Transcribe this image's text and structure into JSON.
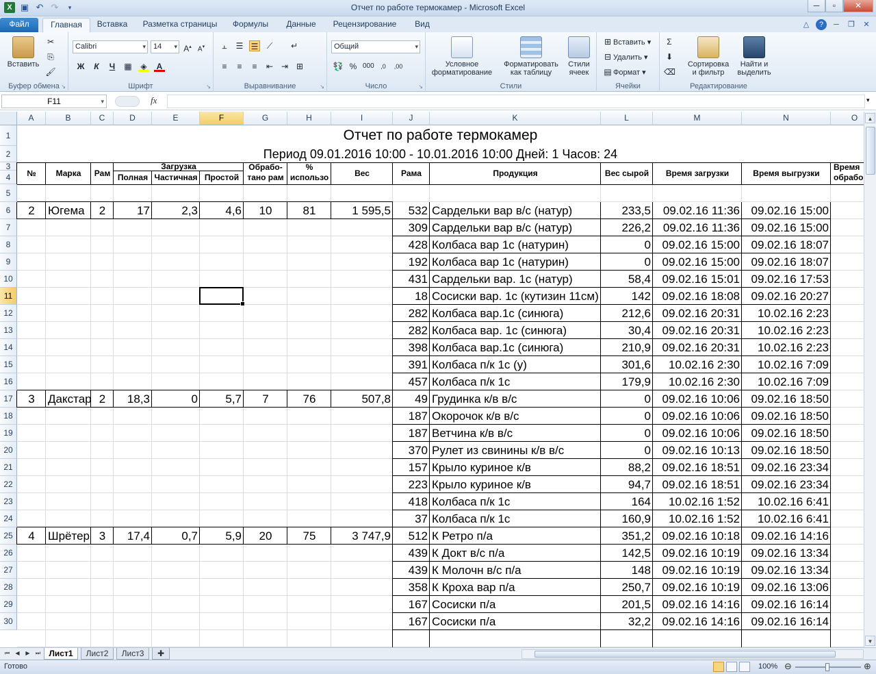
{
  "window": {
    "title": "Отчет по работе термокамер  -  Microsoft Excel",
    "min_icon": "minimize-icon",
    "max_icon": "maximize-icon",
    "close_icon": "close-icon"
  },
  "ribbon_tabs": [
    "Файл",
    "Главная",
    "Вставка",
    "Разметка страницы",
    "Формулы",
    "Данные",
    "Рецензирование",
    "Вид"
  ],
  "active_tab": "Главная",
  "ribbon": {
    "clipboard": {
      "label": "Буфер обмена",
      "paste": "Вставить"
    },
    "font": {
      "label": "Шрифт",
      "name": "Calibri",
      "size": "14",
      "bold": "Ж",
      "italic": "К",
      "underline": "Ч"
    },
    "alignment": {
      "label": "Выравнивание"
    },
    "number": {
      "label": "Число",
      "format": "Общий"
    },
    "styles": {
      "label": "Стили",
      "conditional": "Условное форматирование",
      "as_table": "Форматировать как таблицу",
      "cell_styles": "Стили ячеек"
    },
    "cells": {
      "label": "Ячейки",
      "insert": "Вставить",
      "delete": "Удалить",
      "format": "Формат"
    },
    "editing": {
      "label": "Редактирование",
      "sort": "Сортировка и фильтр",
      "find": "Найти и выделить"
    }
  },
  "formula_bar": {
    "name_box": "F11",
    "fx": "fx",
    "content": ""
  },
  "columns": [
    "A",
    "B",
    "C",
    "D",
    "E",
    "F",
    "G",
    "H",
    "I",
    "J",
    "K",
    "L",
    "M",
    "N",
    "O"
  ],
  "selected_column": "F",
  "rows": [
    "1",
    "2",
    "3",
    "4",
    "5",
    "6",
    "7",
    "8",
    "9",
    "10",
    "11",
    "12",
    "13",
    "14",
    "15",
    "16",
    "17",
    "18",
    "19",
    "20",
    "21",
    "22",
    "23",
    "24",
    "25",
    "26",
    "27",
    "28",
    "29",
    "30"
  ],
  "selected_row": "11",
  "sheet": {
    "title": "Отчет по работе термокамер",
    "period": "Период 09.01.2016 10:00 - 10.01.2016 10:00  Дней: 1  Часов: 24",
    "headers": {
      "num": "№",
      "brand": "Марка",
      "frames": "Рам",
      "load": "Загрузка",
      "full": "Полная",
      "partial": "Частичная",
      "idle": "Простой",
      "processed_1": "Обрабо-",
      "processed_2": "тано рам",
      "percent_1": "%",
      "percent_2": "использо",
      "weight": "Вес",
      "frame": "Рама",
      "product": "Продукция",
      "raw_weight": "Вес сырой",
      "load_time": "Время загрузки",
      "unload_time": "Время выгрузки",
      "proc_time_1": "Время",
      "proc_time_2": "обрабо"
    },
    "chambers": [
      {
        "num": "2",
        "brand": "Югема",
        "frames": "2",
        "full": "17",
        "partial": "2,3",
        "idle": "4,6",
        "processed": "10",
        "percent": "81",
        "weight": "1 595,5"
      },
      {
        "num": "3",
        "brand": "Дакстар",
        "frames": "2",
        "full": "18,3",
        "partial": "0",
        "idle": "5,7",
        "processed": "7",
        "percent": "76",
        "weight": "507,8"
      },
      {
        "num": "4",
        "brand": "Шрётер",
        "frames": "3",
        "full": "17,4",
        "partial": "0,7",
        "idle": "5,9",
        "processed": "20",
        "percent": "75",
        "weight": "3 747,9"
      }
    ],
    "items": [
      {
        "frame": "532",
        "product": "Сардельки  вар в/с (натур)",
        "raw": "233,5",
        "load": "09.02.16 11:36",
        "unload": "09.02.16 15:00"
      },
      {
        "frame": "309",
        "product": "Сардельки вар в/с (натур)",
        "raw": "226,2",
        "load": "09.02.16 11:36",
        "unload": "09.02.16 15:00"
      },
      {
        "frame": "428",
        "product": "Колбаса  вар 1с (натурин)",
        "raw": "0",
        "load": "09.02.16 15:00",
        "unload": "09.02.16 18:07"
      },
      {
        "frame": "192",
        "product": "Колбаса вар 1с (натурин)",
        "raw": "0",
        "load": "09.02.16 15:00",
        "unload": "09.02.16 18:07"
      },
      {
        "frame": "431",
        "product": "Сардельки вар. 1с (натур)",
        "raw": "58,4",
        "load": "09.02.16 15:01",
        "unload": "09.02.16 17:53"
      },
      {
        "frame": "18",
        "product": "Сосиски вар. 1с (кутизин 11см)",
        "raw": "142",
        "load": "09.02.16 18:08",
        "unload": "09.02.16 20:27"
      },
      {
        "frame": "282",
        "product": "Колбаса  вар.1с (синюга)",
        "raw": "212,6",
        "load": "09.02.16 20:31",
        "unload": "10.02.16 2:23"
      },
      {
        "frame": "282",
        "product": "Колбаса вар. 1с (синюга)",
        "raw": "30,4",
        "load": "09.02.16 20:31",
        "unload": "10.02.16 2:23"
      },
      {
        "frame": "398",
        "product": "Колбаса вар.1с (синюга)",
        "raw": "210,9",
        "load": "09.02.16 20:31",
        "unload": "10.02.16 2:23"
      },
      {
        "frame": "391",
        "product": "Колбаса п/к 1с (у)",
        "raw": "301,6",
        "load": "10.02.16 2:30",
        "unload": "10.02.16 7:09"
      },
      {
        "frame": "457",
        "product": "Колбаса  п/к 1с",
        "raw": "179,9",
        "load": "10.02.16 2:30",
        "unload": "10.02.16 7:09"
      },
      {
        "frame": "49",
        "product": "Грудинка  к/в в/с",
        "raw": "0",
        "load": "09.02.16 10:06",
        "unload": "09.02.16 18:50"
      },
      {
        "frame": "187",
        "product": "Окорочок к/в в/с",
        "raw": "0",
        "load": "09.02.16 10:06",
        "unload": "09.02.16 18:50"
      },
      {
        "frame": "187",
        "product": "Ветчина  к/в в/с",
        "raw": "0",
        "load": "09.02.16 10:06",
        "unload": "09.02.16 18:50"
      },
      {
        "frame": "370",
        "product": "Рулет  из свинины к/в в/с",
        "raw": "0",
        "load": "09.02.16 10:13",
        "unload": "09.02.16 18:50"
      },
      {
        "frame": "157",
        "product": "Крыло куриное к/в",
        "raw": "88,2",
        "load": "09.02.16 18:51",
        "unload": "09.02.16 23:34"
      },
      {
        "frame": "223",
        "product": "Крыло куриное к/в",
        "raw": "94,7",
        "load": "09.02.16 18:51",
        "unload": "09.02.16 23:34"
      },
      {
        "frame": "418",
        "product": "Колбаса  п/к 1с",
        "raw": "164",
        "load": "10.02.16 1:52",
        "unload": "10.02.16 6:41"
      },
      {
        "frame": "37",
        "product": "Колбаса  п/к 1с",
        "raw": "160,9",
        "load": "10.02.16 1:52",
        "unload": "10.02.16 6:41"
      },
      {
        "frame": "512",
        "product": "К Ретро  п/а",
        "raw": "351,2",
        "load": "09.02.16 10:18",
        "unload": "09.02.16 14:16"
      },
      {
        "frame": "439",
        "product": "К Докт в/с п/а",
        "raw": "142,5",
        "load": "09.02.16 10:19",
        "unload": "09.02.16 13:34"
      },
      {
        "frame": "439",
        "product": "К Молочн в/с п/а",
        "raw": "148",
        "load": "09.02.16 10:19",
        "unload": "09.02.16 13:34"
      },
      {
        "frame": "358",
        "product": "К Кроха вар п/а",
        "raw": "250,7",
        "load": "09.02.16 10:19",
        "unload": "09.02.16 13:06"
      },
      {
        "frame": "167",
        "product": "Сосиски п/а",
        "raw": "201,5",
        "load": "09.02.16 14:16",
        "unload": "09.02.16 16:14"
      },
      {
        "frame": "167",
        "product": "Сосиски п/а",
        "raw": "32,2",
        "load": "09.02.16 14:16",
        "unload": "09.02.16 16:14"
      }
    ]
  },
  "sheet_tabs": [
    "Лист1",
    "Лист2",
    "Лист3"
  ],
  "active_sheet": "Лист1",
  "status": {
    "ready": "Готово",
    "zoom": "100%"
  }
}
